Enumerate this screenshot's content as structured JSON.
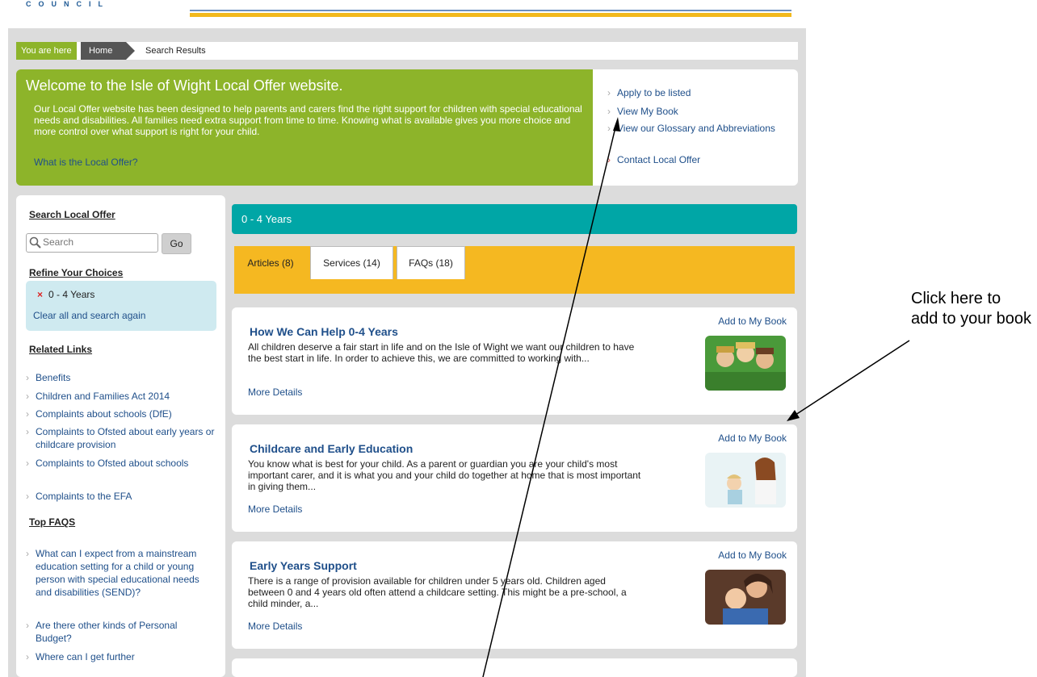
{
  "header": {
    "council_label": "COUNCIL"
  },
  "breadcrumb": {
    "here_label": "You are here",
    "home_label": "Home",
    "current_label": "Search Results"
  },
  "welcome": {
    "title": "Welcome to the Isle of Wight Local Offer website.",
    "body": "Our Local Offer website has been designed to help parents and carers find the right support for children with special educational needs and disabilities. All families need extra support from time to time. Knowing what is available gives you more choice and more control over what support is right for your child.",
    "link": "What is the Local Offer?"
  },
  "quick_links": [
    {
      "label": "Apply to be listed"
    },
    {
      "label": "View My Book"
    },
    {
      "label": "View our Glossary and Abbreviations"
    },
    {
      "label": "Contact Local Offer"
    }
  ],
  "sidebar": {
    "search_heading": "Search Local Offer",
    "search_placeholder": "Search",
    "go_label": "Go",
    "refine_heading": "Refine Your Choices",
    "refine_selected": "0 - 4 Years",
    "refine_clear": "Clear all and search again",
    "related_heading": "Related Links",
    "related_links": [
      {
        "label": "Benefits"
      },
      {
        "label": "Children and Families Act 2014"
      },
      {
        "label": "Complaints about schools (DfE)"
      },
      {
        "label": "Complaints to Ofsted about early years or childcare provision"
      },
      {
        "label": "Complaints to Ofsted about schools"
      },
      {
        "label": "Complaints to the EFA"
      }
    ],
    "faq_heading": "Top FAQS",
    "faqs": [
      {
        "label": "What can I expect from a mainstream education setting for a child or young person with special educational needs and disabilities (SEND)?"
      },
      {
        "label": "Are there other kinds of Personal Budget?"
      },
      {
        "label": "Where can I get further"
      }
    ]
  },
  "results": {
    "topic": "0 - 4 Years",
    "tabs": [
      {
        "label": "Articles (8)"
      },
      {
        "label": "Services (14)"
      },
      {
        "label": "FAQs (18)"
      }
    ],
    "cards": [
      {
        "title": "How We Can Help 0-4 Years",
        "text": "All children deserve a fair start in life and on the Isle of Wight we want our children to have the best start in life.  In order to achieve this, we are committed to working with...",
        "more": "More Details",
        "add": "Add to My Book"
      },
      {
        "title": "Childcare and Early Education",
        "text": "You know what is best for your child. As a parent or guardian you are your child's most important carer, and it is what you and your child do together at home that is most important in giving them...",
        "more": "More Details",
        "add": "Add to My Book"
      },
      {
        "title": "Early Years Support",
        "text": "There is a range of provision available for children under 5 years old. Children aged between 0 and 4 years old often attend a childcare setting. This might be a pre-school, a child minder, a...",
        "more": "More Details",
        "add": "Add to My Book"
      }
    ]
  },
  "annotation": {
    "text": "Click here to add to your book"
  },
  "colors": {
    "green": "#8db42a",
    "teal": "#00a6a6",
    "yellow": "#f5b821",
    "link": "#1f4f8a",
    "bg": "#dcdcdc"
  }
}
